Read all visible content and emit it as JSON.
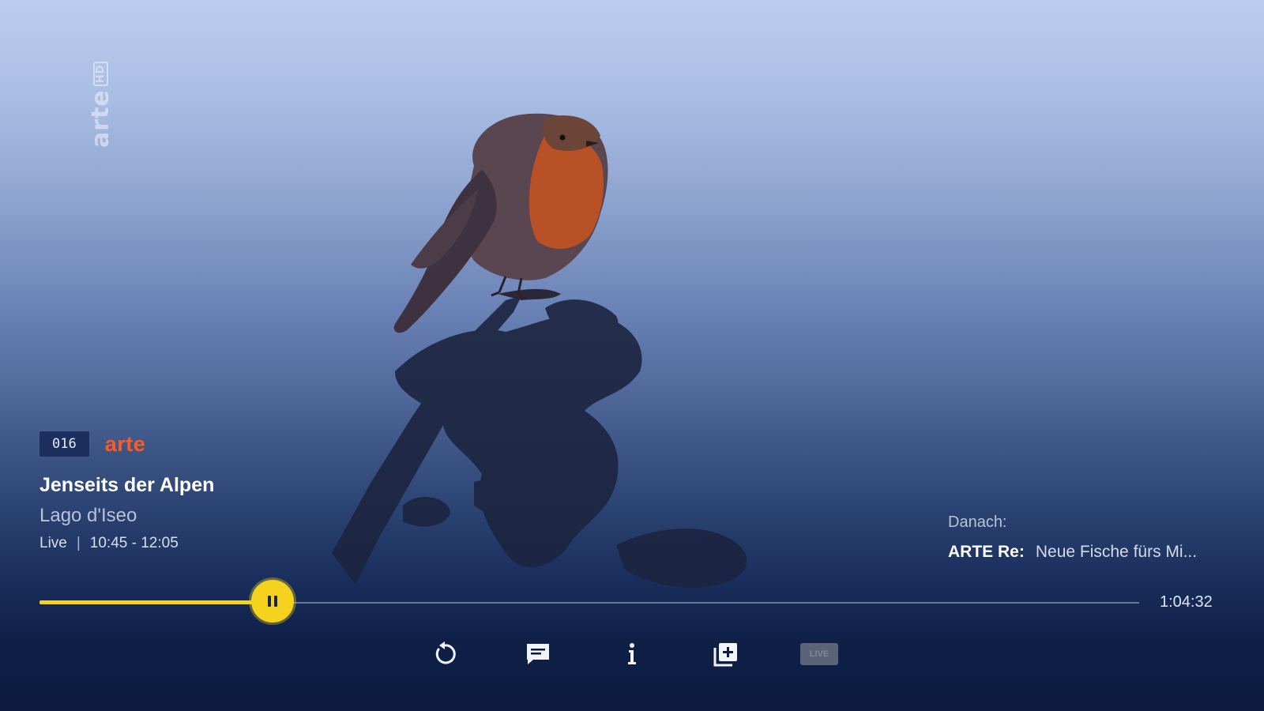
{
  "player": {
    "watermark": {
      "text": "arte",
      "badge": "HD"
    },
    "channel": {
      "number": "016",
      "logo_text": "arte"
    },
    "program": {
      "title": "Jenseits der Alpen",
      "subtitle": "Lago d'Iseo",
      "status": "Live",
      "separator": "|",
      "time_range": "10:45 - 12:05"
    },
    "up_next": {
      "label": "Danach:",
      "show": "ARTE Re:",
      "title": "Neue Fische fürs Mi..."
    },
    "progress": {
      "fraction": 0.196,
      "remaining": "1:04:32"
    },
    "controls": {
      "icons": [
        "pause-icon",
        "restart-icon",
        "subtitles-icon",
        "info-icon",
        "add-to-list-icon"
      ],
      "live_label": "LIVE"
    },
    "colors": {
      "accent": "#f4d21e",
      "brand": "#ff5a1f",
      "background": "#0b1a3d"
    }
  }
}
